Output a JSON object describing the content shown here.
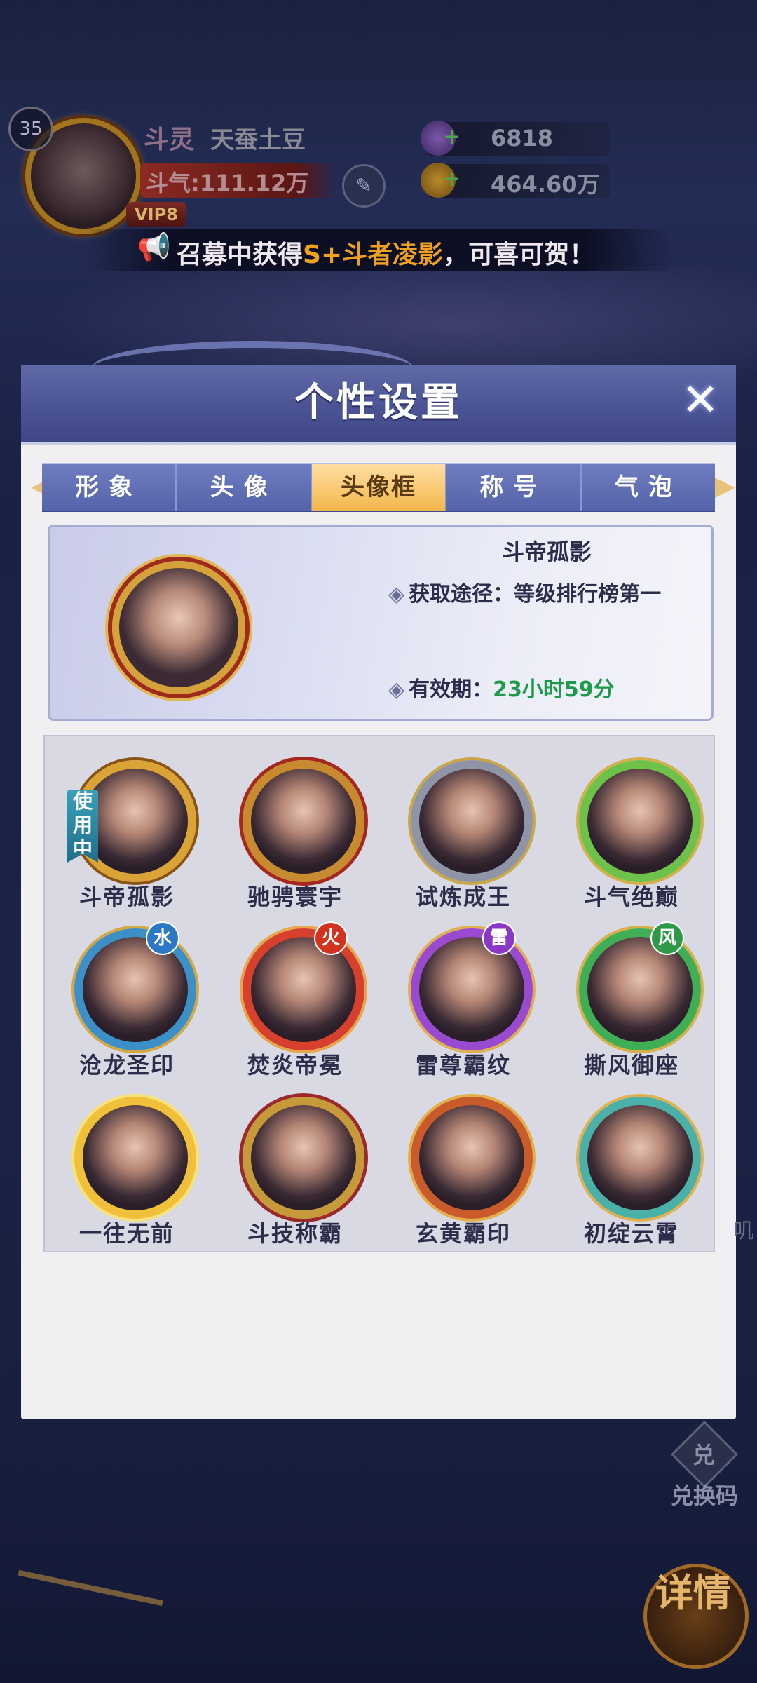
{
  "hud": {
    "level": "35",
    "player_tag": "斗灵",
    "player_name": "天蚕土豆",
    "power": "斗气:111.12万",
    "vip": "VIP8",
    "resource_1": "6818",
    "resource_2": "464.60万"
  },
  "announcement": {
    "prefix": "召募中获得",
    "highlight": "S+斗者凌影",
    "suffix": "，可喜可贺！"
  },
  "dialog": {
    "title": "个性设置",
    "tabs": [
      {
        "label": "形象",
        "active": false
      },
      {
        "label": "头像",
        "active": false
      },
      {
        "label": "头像框",
        "active": true
      },
      {
        "label": "称号",
        "active": false
      },
      {
        "label": "气泡",
        "active": false
      }
    ],
    "selected": {
      "name": "斗帝孤影",
      "source_label": "获取途径：",
      "source_value": "等级排行榜第一",
      "expire_label": "有效期：",
      "expire_value": "23小时59分"
    },
    "in_use_label": "使用中",
    "frames": [
      {
        "name": "斗帝孤影",
        "badge": "",
        "in_use": true
      },
      {
        "name": "驰骋寰宇",
        "badge": ""
      },
      {
        "name": "试炼成王",
        "badge": ""
      },
      {
        "name": "斗气绝巅",
        "badge": ""
      },
      {
        "name": "沧龙圣印",
        "badge": "水"
      },
      {
        "name": "焚炎帝冕",
        "badge": "火"
      },
      {
        "name": "雷尊霸纹",
        "badge": "雷"
      },
      {
        "name": "撕风御座",
        "badge": "风"
      },
      {
        "name": "一往无前",
        "badge": ""
      },
      {
        "name": "斗技称霸",
        "badge": ""
      },
      {
        "name": "玄黄霸印",
        "badge": ""
      },
      {
        "name": "初绽云霄",
        "badge": ""
      }
    ]
  },
  "bottom": {
    "redeem_glyph": "兑",
    "redeem_label": "兑换码",
    "detail_label": "详情",
    "side_text": "叽"
  },
  "colors": {
    "accent_gold": "#f2b64b",
    "green_text": "#1d9b4c",
    "header_blue": "#4b5494"
  }
}
